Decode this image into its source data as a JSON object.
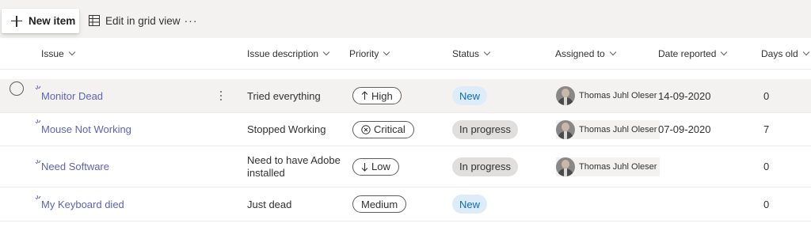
{
  "commandbar": {
    "new_item": "New item",
    "edit_grid": "Edit in grid view",
    "more": "···"
  },
  "columns": [
    "Issue",
    "Issue description",
    "Priority",
    "Status",
    "Assigned to",
    "Date reported",
    "Days old"
  ],
  "rows": [
    {
      "issue": "Monitor Dead",
      "description": "Tried everything",
      "priority": "High",
      "priority_icon": "arrow-up-icon",
      "status": "New",
      "assigned": "Thomas Juhl Oleser",
      "date": "14-09-2020",
      "days": "0"
    },
    {
      "issue": "Mouse Not Working",
      "description": "Stopped Working",
      "priority": "Critical",
      "priority_icon": "circle-x-icon",
      "status": "In progress",
      "assigned": "Thomas Juhl Oleser",
      "date": "07-09-2020",
      "days": "7"
    },
    {
      "issue": "Need Software",
      "description_line1": "Need to have Adobe",
      "description_line2": "installed",
      "priority": "Low",
      "priority_icon": "arrow-down-icon",
      "status": "In progress",
      "assigned": "Thomas Juhl Oleser",
      "date": "",
      "days": "0"
    },
    {
      "issue": "My Keyboard died",
      "description": "Just dead",
      "priority": "Medium",
      "status": "New",
      "assigned": "",
      "date": "",
      "days": "0"
    }
  ],
  "colors": {
    "link": "#5c63b8",
    "new_status_bg": "#deecf9",
    "new_status_text": "#0f6cbd",
    "progress_bg": "#e1dfdd",
    "commandbar_bg": "#f3f2f1"
  }
}
